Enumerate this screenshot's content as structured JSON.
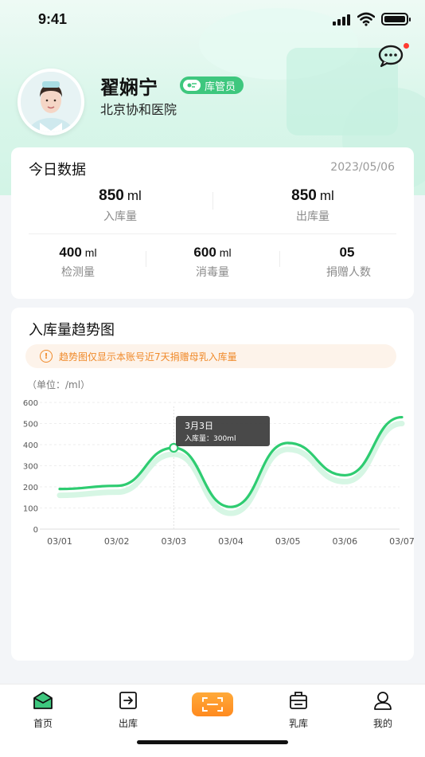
{
  "status_bar": {
    "time": "9:41"
  },
  "profile": {
    "name": "翟娴宁",
    "role": "库管员",
    "hospital": "北京协和医院"
  },
  "today": {
    "title": "今日数据",
    "date": "2023/05/06",
    "primary": [
      {
        "value": "850",
        "unit": "ml",
        "label": "入库量"
      },
      {
        "value": "850",
        "unit": "ml",
        "label": "出库量"
      }
    ],
    "secondary": [
      {
        "value": "400",
        "unit": "ml",
        "label": "检测量"
      },
      {
        "value": "600",
        "unit": "ml",
        "label": "消毒量"
      },
      {
        "value": "05",
        "unit": "",
        "label": "捐赠人数"
      }
    ]
  },
  "trend": {
    "title": "入库量趋势图",
    "notice": "趋势图仅显示本账号近7天捐赠母乳入库量",
    "unit_label": "（单位：/ml）",
    "tooltip": {
      "title": "3月3日",
      "text": "入库量：300ml"
    }
  },
  "chart_data": {
    "type": "line",
    "categories": [
      "03/01",
      "03/02",
      "03/03",
      "03/04",
      "03/05",
      "03/06",
      "03/07"
    ],
    "series": [
      {
        "values": [
          190,
          205,
          385,
          105,
          408,
          255,
          530
        ]
      }
    ],
    "y_ticks": [
      0,
      100,
      200,
      300,
      400,
      500,
      600
    ],
    "ylim": [
      0,
      600
    ],
    "grid": true,
    "highlight_index": 2,
    "line_color": "#2ecc71"
  },
  "tabbar": {
    "items": [
      {
        "label": "首页",
        "icon": "home-icon"
      },
      {
        "label": "出库",
        "icon": "outbound-icon"
      },
      {
        "label": "",
        "icon": "scan-icon"
      },
      {
        "label": "乳库",
        "icon": "milk-bank-icon"
      },
      {
        "label": "我的",
        "icon": "profile-icon"
      }
    ]
  },
  "colors": {
    "accent": "#3ec77e",
    "warning": "#f08a2a",
    "scan": "#ff9a2a"
  }
}
